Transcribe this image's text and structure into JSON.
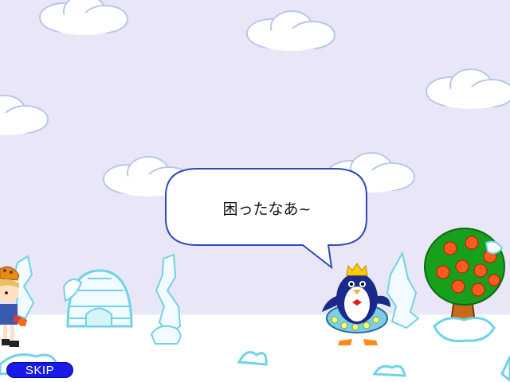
{
  "scene": {
    "speech_bubble": {
      "text": "困ったなあ~"
    },
    "skip_button": {
      "label": "SKIP"
    }
  },
  "colors": {
    "sky": "#e9e6f7",
    "snow": "#ffffff",
    "ice": "#6fd3e6",
    "bubble_border": "#2c4bb8",
    "skip_button": "#1a1ae6"
  },
  "characters": [
    {
      "name": "penguin-with-crown"
    },
    {
      "name": "girl-with-basket"
    }
  ],
  "icons": [
    "cloud",
    "igloo",
    "ice-crystal",
    "orange-tree",
    "snow-mound"
  ]
}
